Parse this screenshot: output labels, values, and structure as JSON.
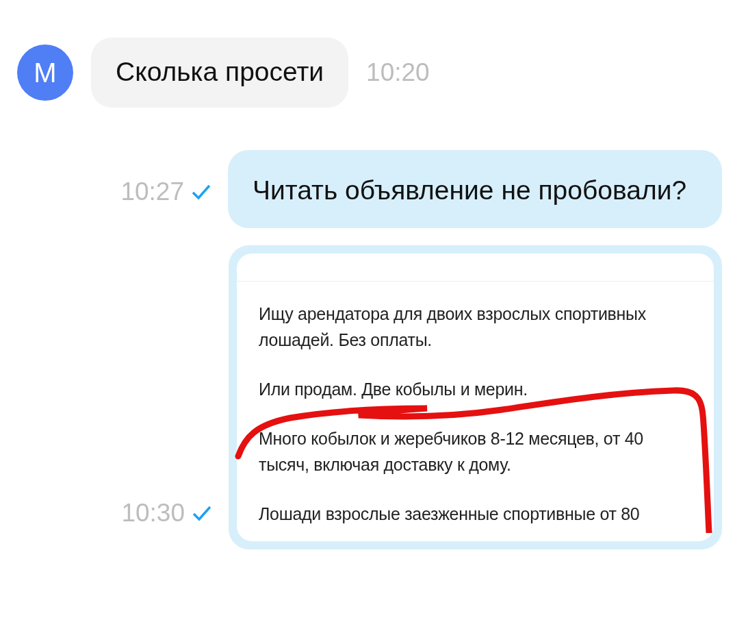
{
  "messages": [
    {
      "kind": "incoming",
      "avatar": "M",
      "text": "Сколька просети",
      "time": "10:20"
    },
    {
      "kind": "outgoing",
      "text": "Читать объявление не пробовали?",
      "time": "10:27",
      "read": true
    },
    {
      "kind": "image",
      "time": "10:30",
      "read": true,
      "paragraphs": [
        "Ищу арендатора для двоих взрослых спортивных лошадей. Без оплаты.",
        "Или продам. Две кобылы и мерин.",
        "Много кобылок и жеребчиков 8-12 месяцев, от 40 тысяч, включая доставку к дому.",
        "Лошади взрослые заезженные спортивные от 80"
      ]
    }
  ]
}
